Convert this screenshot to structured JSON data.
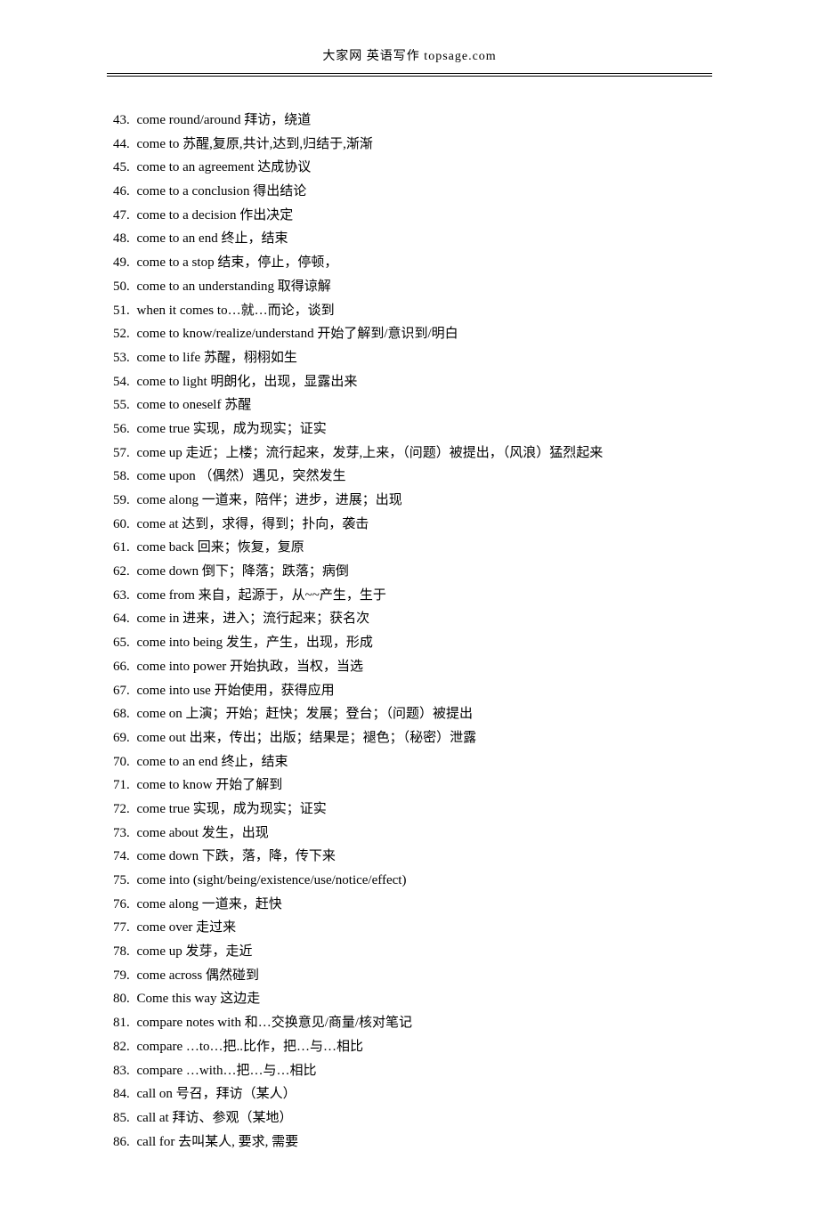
{
  "header": "大家网  英语写作  topsage.com",
  "start_number": 43,
  "entries": [
    "come round/around  拜访，绕道",
    "come to   苏醒,复原,共计,达到,归结于,渐渐",
    "come to an agreement  达成协议",
    "come to a conclusion  得出结论",
    "come to a decision  作出决定",
    "come to an end   终止，结束",
    "come to a stop  结束，停止，停顿，",
    "come to an understanding  取得谅解",
    "when it comes to…就…而论，谈到",
    "come to know/realize/understand 开始了解到/意识到/明白",
    "come to life  苏醒，栩栩如生",
    "come to light  明朗化，出现，显露出来",
    "come to oneself 苏醒",
    "come true   实现，成为现实；证实",
    "come up 走近；上楼；流行起来，发芽,上来，（问题）被提出，（风浪）猛烈起来",
    "come upon  （偶然）遇见，突然发生",
    "come along   一道来，陪伴；进步，进展；出现",
    "come at   达到，求得，得到；扑向，袭击",
    "come back   回来；恢复，复原",
    "come down   倒下；降落；跌落；病倒",
    "come from   来自，起源于，从~~产生，生于",
    "come in   进来，进入；流行起来；获名次",
    "come into being   发生，产生，出现，形成",
    "come into power   开始执政，当权，当选",
    "come into use   开始使用，获得应用",
    "come on   上演；开始；赶快；发展；登台；（问题）被提出",
    "come out   出来，传出；出版；结果是；褪色；（秘密）泄露",
    "come to an end   终止，结束",
    "come to know   开始了解到",
    "come true   实现，成为现实；证实",
    "come about 发生，出现",
    "come down 下跌，落，降，传下来",
    "come into (sight/being/existence/use/notice/effect)",
    "come along 一道来，赶快",
    "come over 走过来",
    "come up 发芽，走近",
    "come across 偶然碰到",
    "Come this way 这边走",
    "compare notes with 和…交换意见/商量/核对笔记",
    "compare …to…把..比作，把…与…相比",
    "compare …with…把…与…相比",
    "call on 号召，拜访（某人）",
    "call at 拜访、参观（某地）",
    "call for 去叫某人,  要求,  需要"
  ]
}
